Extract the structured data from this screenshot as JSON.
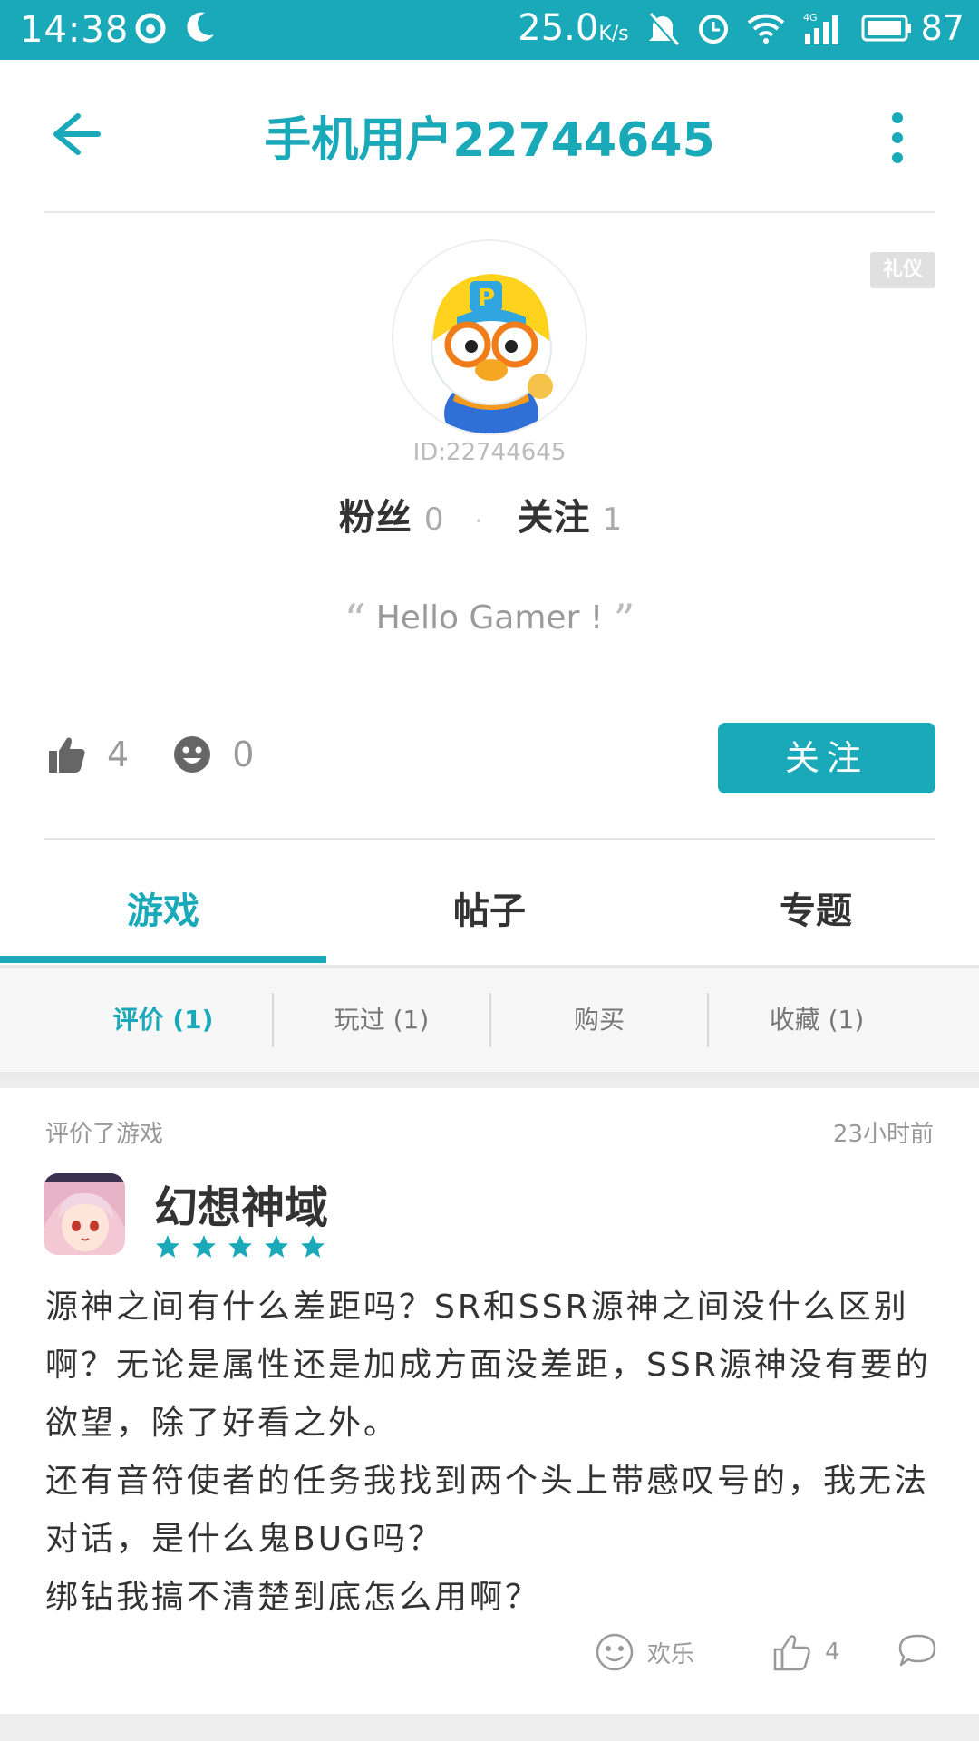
{
  "status_bar": {
    "time": "14:38",
    "speed": "25.0",
    "speed_unit": "K/s",
    "battery": "87"
  },
  "nav": {
    "title": "手机用户22744645"
  },
  "profile": {
    "medal": "礼仪",
    "id_text": "ID:22744645",
    "fans_label": "粉丝",
    "fans_count": "0",
    "follow_label": "关注",
    "follow_count": "1",
    "signature": "Hello Gamer !",
    "likes": "4",
    "emoji_count": "0",
    "follow_button": "关注"
  },
  "tabs": [
    {
      "label": "游戏",
      "active": true
    },
    {
      "label": "帖子",
      "active": false
    },
    {
      "label": "专题",
      "active": false
    }
  ],
  "subtabs": [
    {
      "label": "评价 (1)",
      "active": true
    },
    {
      "label": "玩过 (1)",
      "active": false
    },
    {
      "label": "购买",
      "active": false
    },
    {
      "label": "收藏 (1)",
      "active": false
    }
  ],
  "review": {
    "header": "评价了游戏",
    "time": "23小时前",
    "game_name": "幻想神域",
    "rating": 5,
    "text": "源神之间有什么差距吗？SR和SSR源神之间没什么区别啊？无论是属性还是加成方面没差距，SSR源神没有要的欲望，除了好看之外。\n还有音符使者的任务我找到两个头上带感叹号的，我无法对话，是什么鬼BUG吗？\n绑钻我搞不清楚到底怎么用啊？",
    "fun_label": "欢乐",
    "like_count": "4"
  },
  "colors": {
    "accent": "#1aa9b9"
  }
}
